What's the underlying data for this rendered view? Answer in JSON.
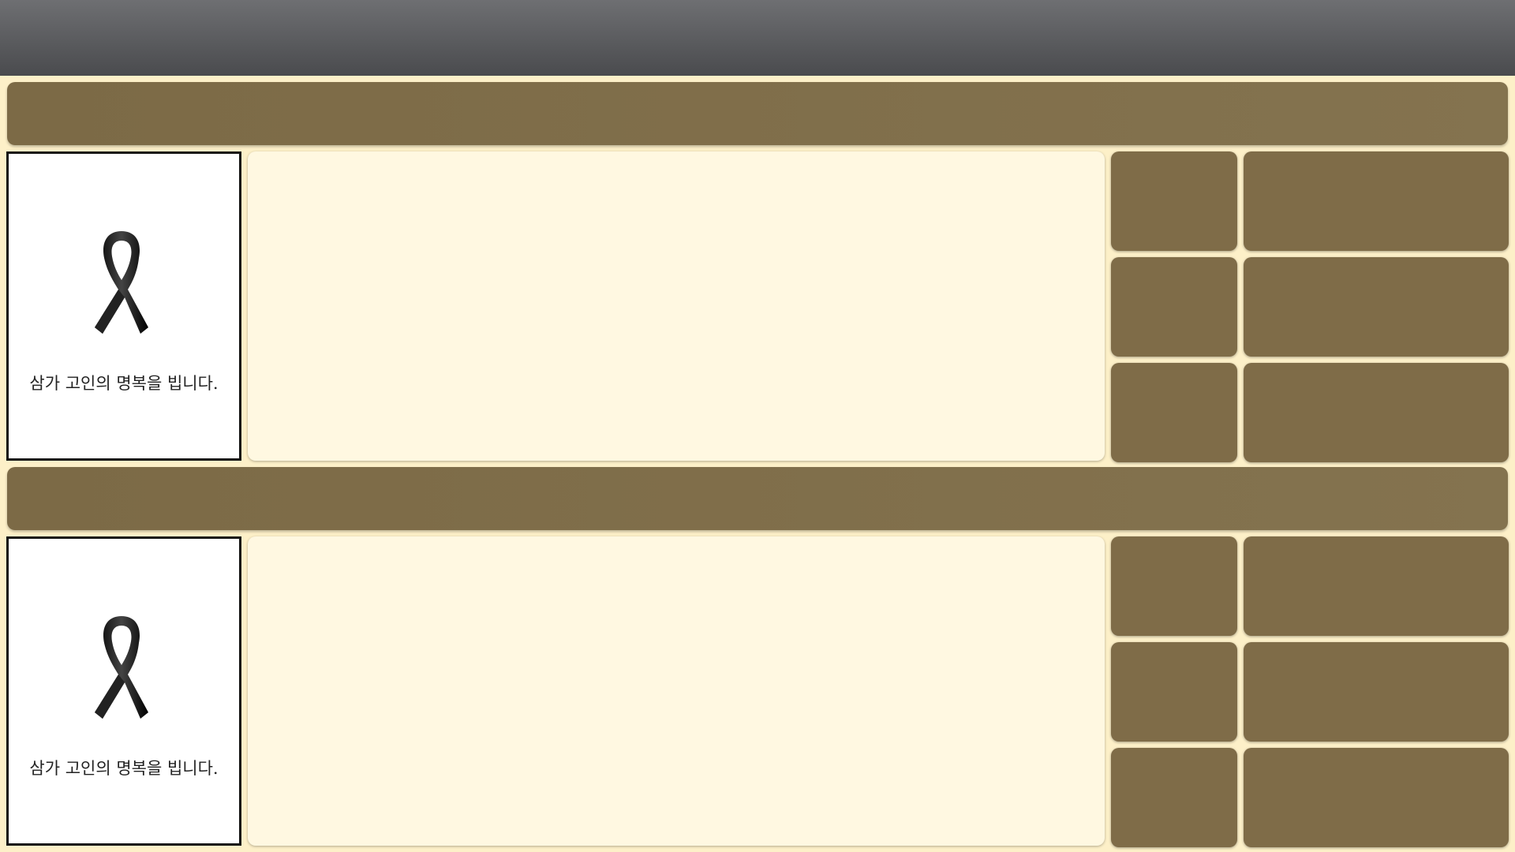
{
  "colors": {
    "topbar": "#5b5c5f",
    "background": "#fdf0c8",
    "banner": "#7f6c48",
    "content_panel": "#fff8e1",
    "tile": "#7f6c48",
    "memorial_border": "#111111"
  },
  "sections": [
    {
      "memorial": {
        "icon": "mourning-ribbon-icon",
        "caption": "삼가 고인의 명복을 빕니다."
      }
    },
    {
      "memorial": {
        "icon": "mourning-ribbon-icon",
        "caption": "삼가 고인의 명복을 빕니다."
      }
    }
  ]
}
